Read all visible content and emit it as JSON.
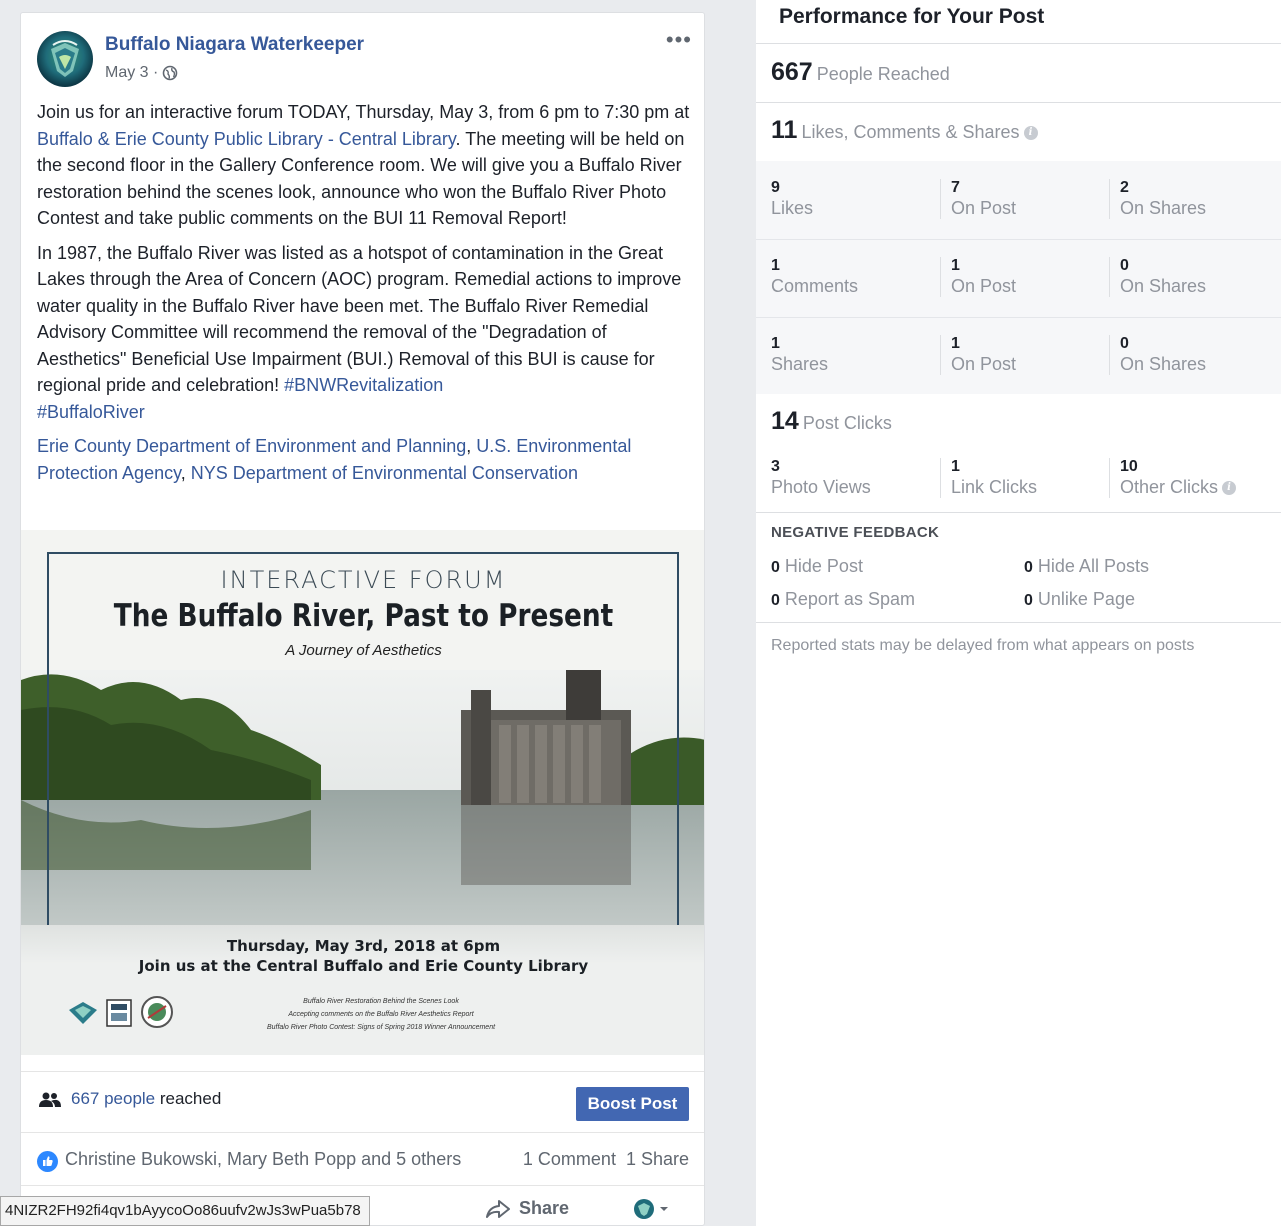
{
  "post": {
    "page_name": "Buffalo Niagara Waterkeeper",
    "date": "May 3 ·",
    "paragraph1_a": "Join us for an interactive forum TODAY, Thursday, May 3, from 6 pm to 7:30 pm at ",
    "paragraph1_link": "Buffalo & Erie County Public Library - Central Library",
    "paragraph1_b": ". The meeting will be held on the second floor in the Gallery Conference room. We will give you a Buffalo River restoration behind the scenes look, announce who won the Buffalo River Photo Contest and take public comments on the BUI 11 Removal Report!",
    "paragraph2": "In 1987, the Buffalo River was listed as a hotspot of contamination in the Great Lakes through the Area of Concern (AOC) program. Remedial actions to improve water quality in the Buffalo River have been met. The Buffalo River Remedial Advisory Committee will recommend the removal of the \"Degradation of Aesthetics\" Beneficial Use Impairment (BUI.) Removal of this BUI is cause for regional pride and celebration! ",
    "hashtag1": "#BNWRevitalization",
    "hashtag2": "#BuffaloRiver",
    "tag1": "Erie County Department of Environment and Planning",
    "tag2": "U.S. Environmental Protection Agency",
    "tag3": "NYS Department of Environmental Conservation",
    "sep": ", "
  },
  "flyer": {
    "subtitle": "INTERACTIVE FORUM",
    "title": "The Buffalo River, Past to Present",
    "tagline": "A Journey of Aesthetics",
    "date_line": "Thursday, May 3rd, 2018 at 6pm",
    "venue_line": "Join us at the Central Buffalo and Erie County Library",
    "item1": "Buffalo River Restoration Behind the Scenes Look",
    "item2": "Accepting comments on the Buffalo River Aesthetics Report",
    "item3": "Buffalo River Photo Contest: Signs of Spring 2018 Winner Announcement"
  },
  "footer": {
    "reach_link": "667 people",
    "reach_suffix": " reached",
    "boost_label": "Boost Post",
    "reactors": "Christine Bukowski, Mary Beth Popp and 5 others",
    "comments": "1 Comment",
    "shares": "1 Share",
    "share_action": "Share",
    "url_tooltip": "4NIZR2FH92fi4qv1bAyycoOo86uufv2wJs3wPua5b78"
  },
  "performance": {
    "title": "Performance for Your Post",
    "reached_num": "667",
    "reached_label": "People Reached",
    "engagement_num": "11",
    "engagement_label": "Likes, Comments & Shares",
    "rows": [
      {
        "total": "9",
        "total_label": "Likes",
        "post": "7",
        "post_label": "On Post",
        "shares": "2",
        "shares_label": "On Shares"
      },
      {
        "total": "1",
        "total_label": "Comments",
        "post": "1",
        "post_label": "On Post",
        "shares": "0",
        "shares_label": "On Shares"
      },
      {
        "total": "1",
        "total_label": "Shares",
        "post": "1",
        "post_label": "On Post",
        "shares": "0",
        "shares_label": "On Shares"
      }
    ],
    "clicks_num": "14",
    "clicks_label": "Post Clicks",
    "clicks": {
      "photo_views": "3",
      "photo_views_label": "Photo Views",
      "link_clicks": "1",
      "link_clicks_label": "Link Clicks",
      "other_clicks": "10",
      "other_clicks_label": "Other Clicks"
    },
    "negative_title": "NEGATIVE FEEDBACK",
    "negative": {
      "hide_post": "0",
      "hide_post_label": " Hide Post",
      "hide_all": "0",
      "hide_all_label": " Hide All Posts",
      "spam": "0",
      "spam_label": " Report as Spam",
      "unlike": "0",
      "unlike_label": " Unlike Page"
    },
    "footnote": "Reported stats may be delayed from what appears on posts"
  },
  "icons": {
    "globe": "globe-icon",
    "more": "more-icon",
    "people": "people-icon",
    "like": "like-icon",
    "share": "share-icon",
    "info": "info-icon"
  },
  "colors": {
    "link": "#365899",
    "boost": "#4267b2",
    "muted": "#90949c"
  }
}
